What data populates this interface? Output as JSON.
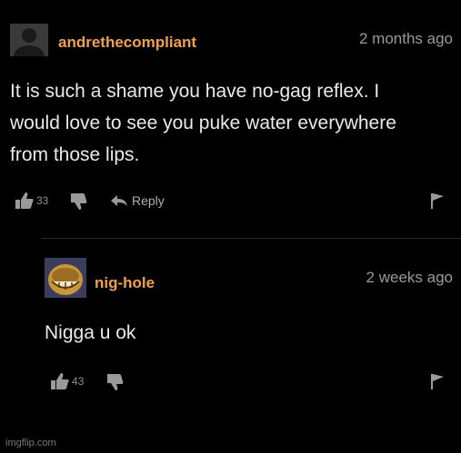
{
  "colors": {
    "background": "#000000",
    "username": "#f0a050",
    "timestamp": "#9a9a9a",
    "text": "#eaeaea",
    "icon": "#9a9a9a"
  },
  "comments": [
    {
      "username": "andrethecompliant",
      "timestamp": "2 months ago",
      "body_lines": [
        "It is such a shame you have no-gag reflex. I",
        "would love to see you puke water everywhere",
        "from those lips."
      ],
      "likes": "33",
      "reply_label": "Reply",
      "icons": [
        "avatar-placeholder",
        "thumbs-up-icon",
        "thumbs-down-icon",
        "reply-arrow-icon",
        "flag-icon"
      ]
    },
    {
      "username": "nig-hole",
      "timestamp": "2 weeks ago",
      "body_lines": [
        "Nigga u ok"
      ],
      "likes": "43",
      "icons": [
        "avatar-image",
        "thumbs-up-icon",
        "thumbs-down-icon",
        "flag-icon"
      ]
    }
  ],
  "watermark": "imgflip.com"
}
